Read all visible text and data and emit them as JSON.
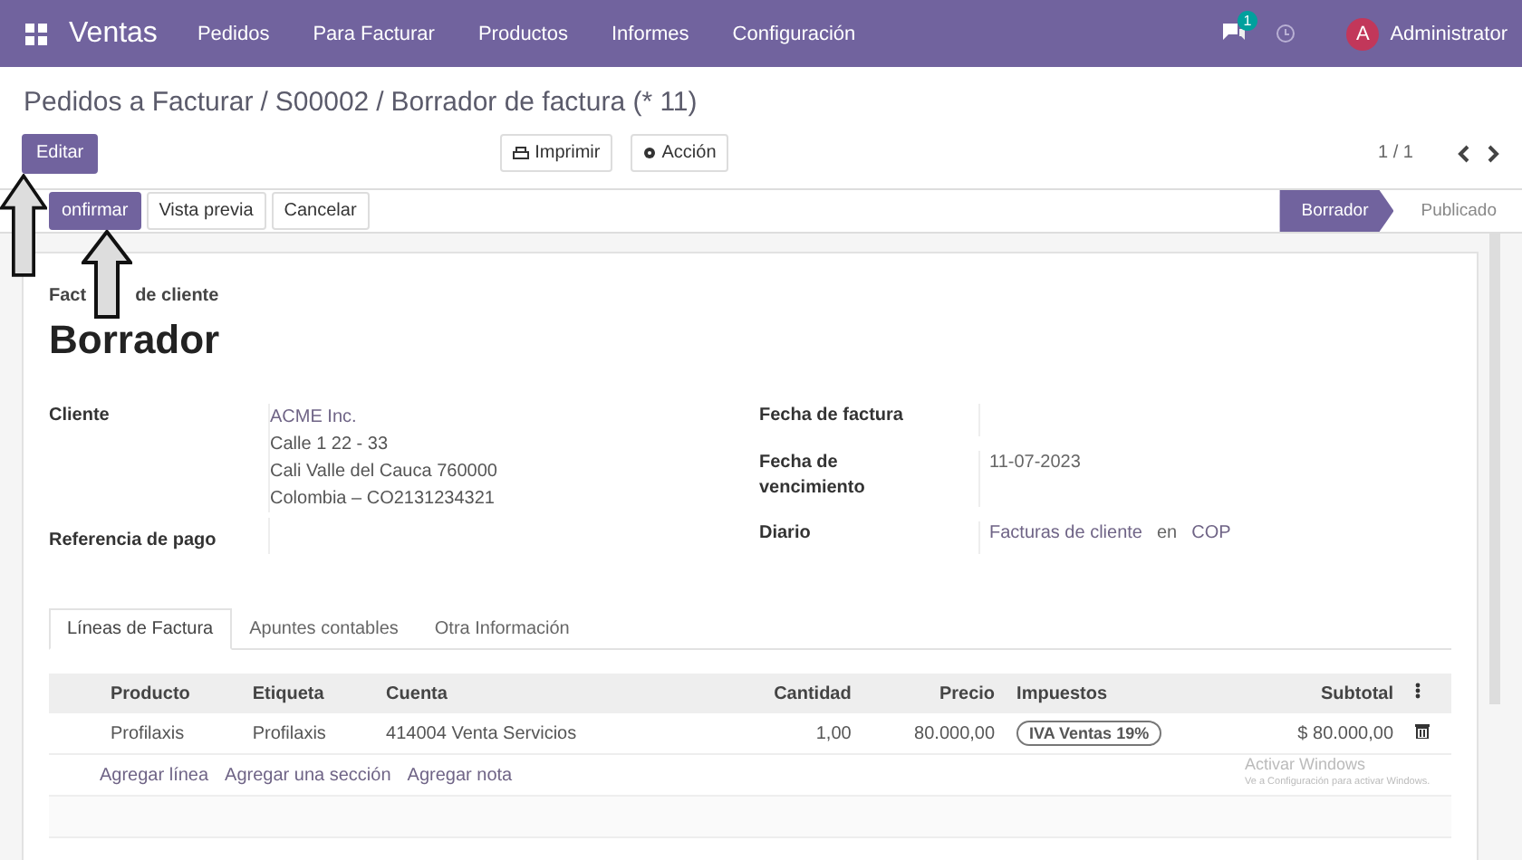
{
  "navbar": {
    "app": "Ventas",
    "menu": [
      "Pedidos",
      "Para Facturar",
      "Productos",
      "Informes",
      "Configuración"
    ],
    "chat_count": "1",
    "avatar": "A",
    "user": "Administrator"
  },
  "breadcrumb": [
    {
      "text": "Pedidos a Facturar"
    },
    {
      "separator": "/",
      "text": "S00002"
    },
    {
      "separator": "/",
      "text": "Borrador de factura (* 11)"
    }
  ],
  "toolbar": {
    "edit": "Editar",
    "print": "Imprimir",
    "action": "Acción",
    "pager": "1 / 1"
  },
  "statusbar": {
    "buttons": [
      {
        "label": "onfirmar",
        "primary": true
      },
      {
        "label": "Vista previa",
        "primary": false
      },
      {
        "label": "Cancelar",
        "primary": false
      }
    ],
    "stages": [
      {
        "label": "Borrador",
        "selected": true
      },
      {
        "label": "Publicado",
        "selected": false
      }
    ]
  },
  "sheet": {
    "subtitle": [
      "Fact",
      "de cliente"
    ],
    "title": "Borrador",
    "left": [
      {
        "label": "Cliente",
        "lines": [
          "ACME Inc.",
          "Calle 1 22 - 33",
          "Cali Valle del Cauca 760000",
          "Colombia – CO2131234321"
        ]
      },
      {
        "label": "Referencia de pago"
      }
    ],
    "right": [
      {
        "label": "Fecha de factura"
      },
      {
        "label": "Fecha de vencimiento",
        "value": "11-07-2023"
      },
      {
        "label": "Diario",
        "value": "Facturas de cliente",
        "extra": [
          "en",
          "COP"
        ]
      }
    ],
    "tabs": [
      {
        "label": "Líneas de Factura",
        "selected": true
      },
      {
        "label": "Apuntes contables",
        "selected": false
      },
      {
        "label": "Otra Información",
        "selected": false
      }
    ],
    "table": {
      "columns": [
        "Producto",
        "Etiqueta",
        "Cuenta",
        "Cantidad",
        "Precio",
        "Impuestos",
        "Subtotal"
      ],
      "rows": [
        {
          "product": "Profilaxis",
          "label": "Profilaxis",
          "account": "414004 Venta Servicios",
          "quantity": "1,00",
          "price": "80.000,00",
          "taxes": [
            "IVA Ventas 19%"
          ],
          "subtotal": "$ 80.000,00"
        }
      ],
      "add_links": [
        "Agregar línea",
        "Agregar una sección",
        "Agregar nota"
      ]
    }
  },
  "os_notice": {
    "title": "Activar Windows",
    "text": "Ve a Configuración para activar Windows."
  }
}
